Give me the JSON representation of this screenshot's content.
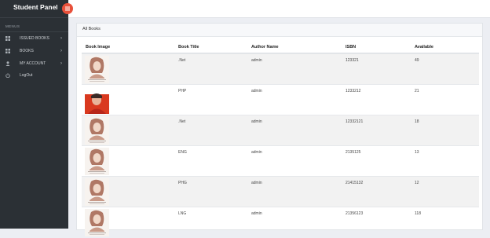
{
  "sidebar": {
    "brand": "Student Panel",
    "menus_label": "MENUS",
    "items": [
      {
        "label": "ISSUED BOOKS",
        "icon": "grid-icon",
        "has_submenu": true
      },
      {
        "label": "BOOKS",
        "icon": "grid-icon",
        "has_submenu": true
      },
      {
        "label": "MY ACCOUNT",
        "icon": "user-icon",
        "has_submenu": true
      },
      {
        "label": "LogOut",
        "icon": "power-icon",
        "has_submenu": false
      }
    ],
    "chevron": "›"
  },
  "panel": {
    "title": "All Books"
  },
  "table": {
    "headers": [
      "Book Image",
      "Book Title",
      "Author Name",
      "ISBN",
      "Available"
    ],
    "rows": [
      {
        "title": ".Net",
        "author": "admin",
        "isbn": "123321",
        "available": "49",
        "image": "sketch"
      },
      {
        "title": "PHP",
        "author": "admin",
        "isbn": "1233212",
        "available": "21",
        "image": "red-cover"
      },
      {
        "title": ".Net",
        "author": "admin",
        "isbn": "12332121",
        "available": "18",
        "image": "sketch"
      },
      {
        "title": "ENG",
        "author": "admin",
        "isbn": "2135125",
        "available": "13",
        "image": "sketch"
      },
      {
        "title": "PHG",
        "author": "admin",
        "isbn": "21415132",
        "available": "12",
        "image": "sketch"
      },
      {
        "title": "LNG",
        "author": "admin",
        "isbn": "21356123",
        "available": "118",
        "image": "sketch"
      }
    ]
  },
  "colors": {
    "sidebar_bg": "#2b3035",
    "accent": "#e8503a",
    "row_alt": "#f2f2f2"
  }
}
